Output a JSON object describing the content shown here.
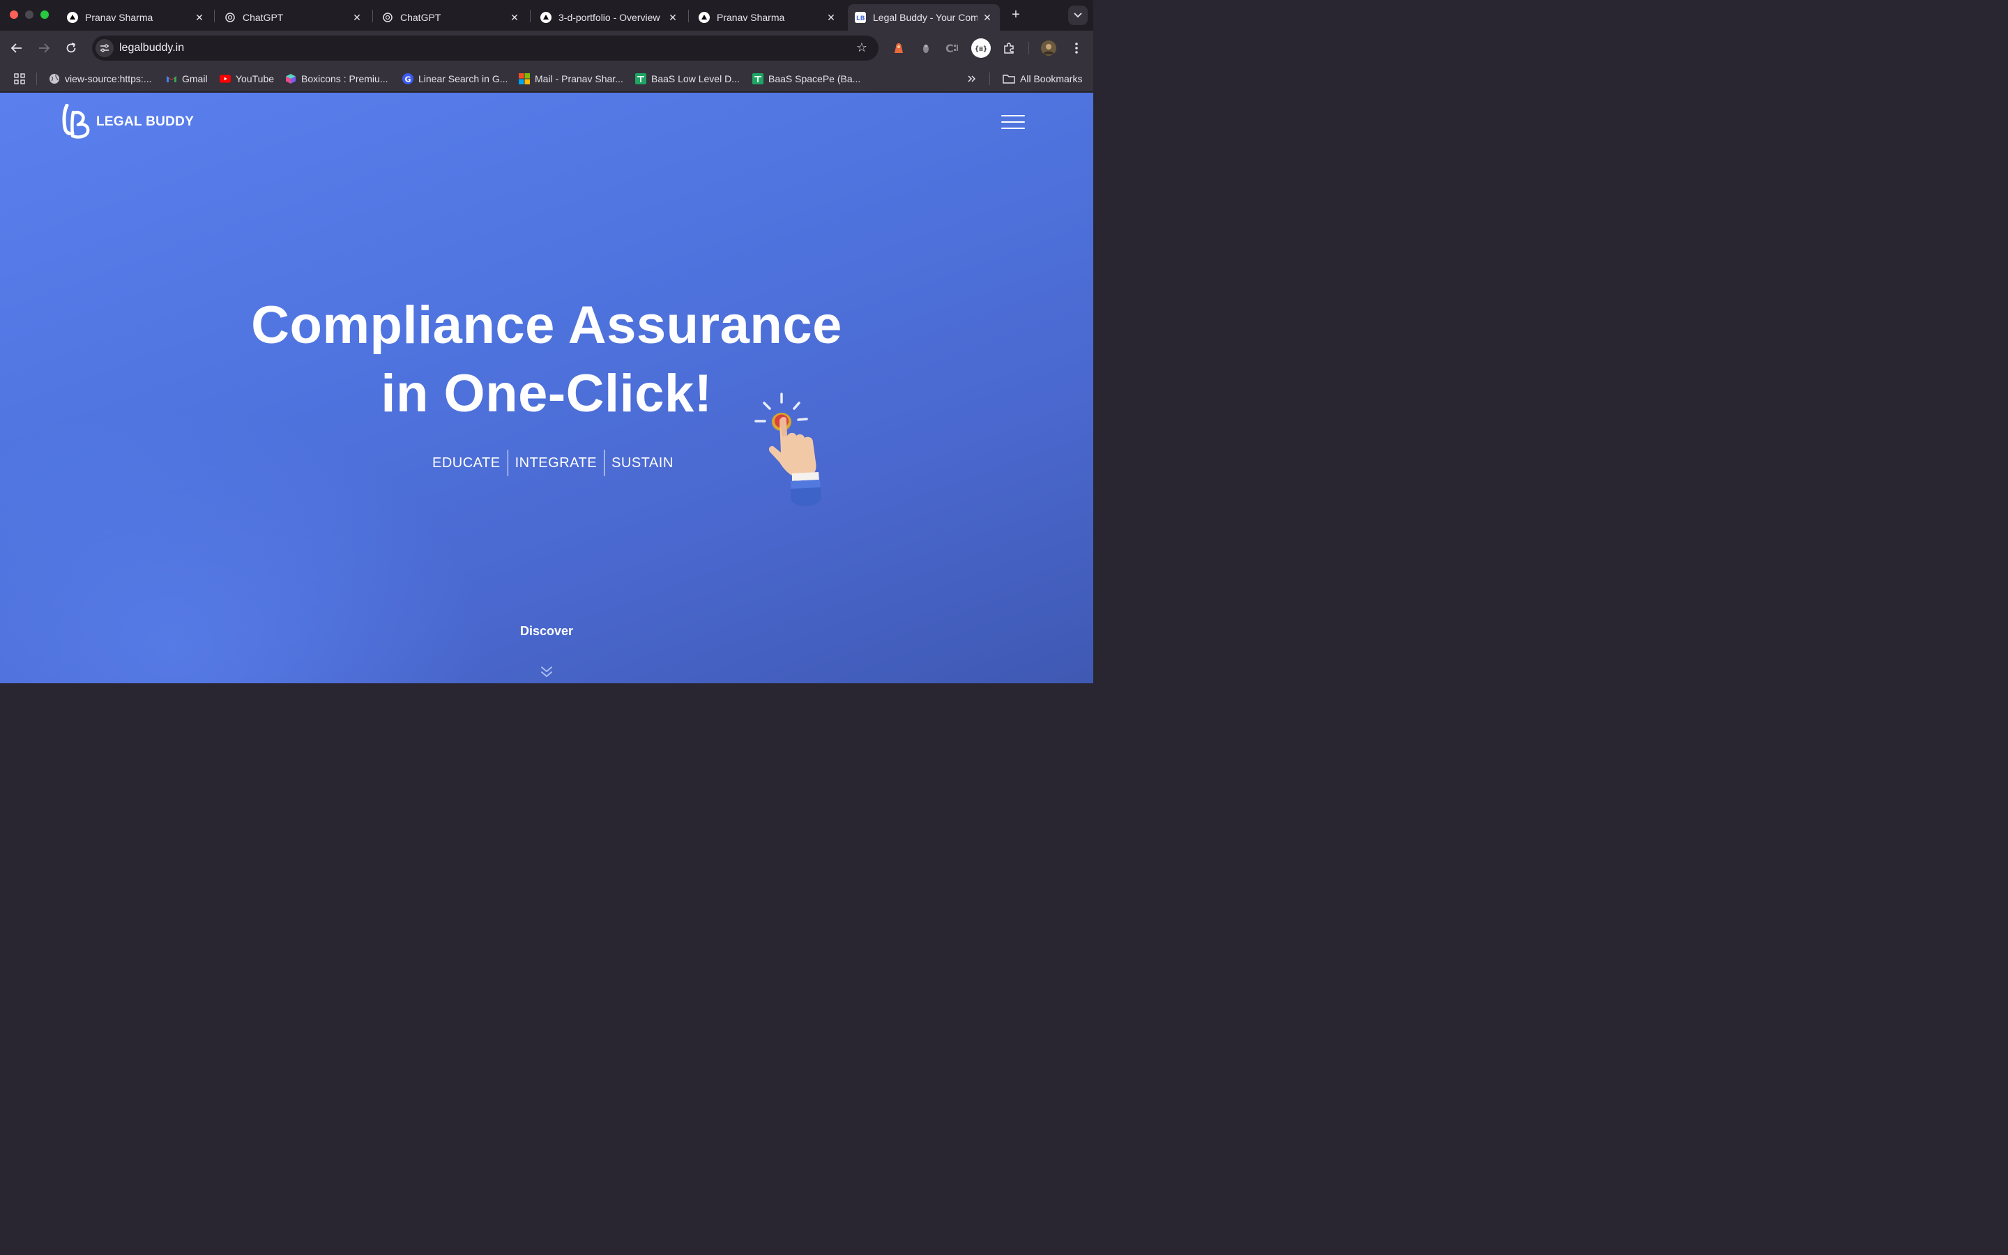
{
  "browser": {
    "tabs": [
      {
        "title": "Pranav Sharma",
        "icon": "vercel-triangle-icon",
        "active": false
      },
      {
        "title": "ChatGPT",
        "icon": "openai-icon",
        "active": false
      },
      {
        "title": "ChatGPT",
        "icon": "openai-icon",
        "active": false
      },
      {
        "title": "3-d-portfolio - Overview",
        "icon": "vercel-triangle-icon",
        "active": false
      },
      {
        "title": "Pranav Sharma",
        "icon": "vercel-triangle-icon",
        "active": false
      },
      {
        "title": "Legal Buddy - Your Com",
        "icon": "legalbuddy-icon",
        "active": true
      }
    ],
    "address": "legalbuddy.in",
    "bookmarks": [
      {
        "label": "view-source:https:...",
        "icon": "globe-icon"
      },
      {
        "label": "Gmail",
        "icon": "gmail-icon"
      },
      {
        "label": "YouTube",
        "icon": "youtube-icon"
      },
      {
        "label": "Boxicons : Premiu...",
        "icon": "boxicons-icon"
      },
      {
        "label": "Linear Search in G...",
        "icon": "g-icon"
      },
      {
        "label": "Mail - Pranav Shar...",
        "icon": "microsoft-icon"
      },
      {
        "label": "BaaS Low Level D...",
        "icon": "sheets-icon"
      },
      {
        "label": "BaaS SpacePe (Ba...",
        "icon": "sheets-icon"
      }
    ],
    "all_bookmarks": "All Bookmarks"
  },
  "site": {
    "logo_text": "LEGAL BUDDY",
    "headline_line1": "Compliance Assurance",
    "headline_line2": "in One-Click!",
    "tagline": [
      "EDUCATE",
      "INTEGRATE",
      "SUSTAIN"
    ],
    "discover": "Discover"
  },
  "colors": {
    "page_bg": "#4f74df",
    "tabstrip_bg": "#201e24",
    "toolbar_bg": "#35323b",
    "omnibox_bg": "#1f1d23"
  }
}
